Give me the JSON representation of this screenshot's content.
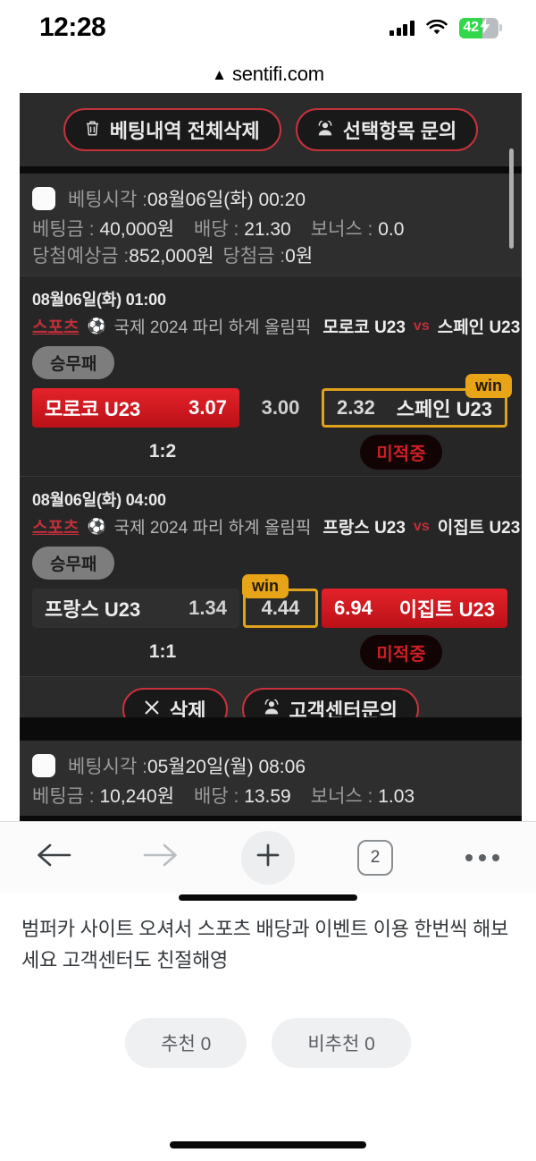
{
  "status_bar": {
    "time": "12:28",
    "battery_percent": "42",
    "battery_charging": true,
    "signal_icon": "cellular-signal-icon",
    "wifi_icon": "wifi-icon"
  },
  "url_bar": {
    "warning_icon": "⚠",
    "host": "sentifi.com"
  },
  "page_toolbar": {
    "delete_all_label": "베팅내역 전체삭제",
    "delete_all_icon": "trash-icon",
    "inquiry_label": "선택항목 문의",
    "inquiry_icon": "agent-headset-icon"
  },
  "slips": [
    {
      "bet_time_label": "베팅시각 :",
      "bet_time_value": "08월06일(화) 00:20",
      "stake_label": "베팅금 : ",
      "stake_value": "40,000원",
      "odds_label": "배당 : ",
      "odds_value": "21.30",
      "bonus_label": "보너스 : ",
      "bonus_value": "0.0",
      "expected_label": "당첨예상금 :",
      "expected_value": "852,000원",
      "payout_label": "당첨금 :",
      "payout_value": "0원",
      "matches": [
        {
          "date": "08월06일(화) 01:00",
          "sports_label": "스포츠",
          "sport_icon": "soccer-ball-icon",
          "league": "국제 2024 파리 하계 올림픽",
          "home_team": "모로코 U23",
          "vs": "vs",
          "away_team": "스페인 U23",
          "market_tag": "승무패",
          "home_odds": "3.07",
          "draw_odds": "3.00",
          "away_odds": "2.32",
          "selected": "away",
          "home_state": "red",
          "away_state": "selected",
          "win_badge": "win",
          "score": "1:2",
          "result_badge": "미적중"
        },
        {
          "date": "08월06일(화) 04:00",
          "sports_label": "스포츠",
          "sport_icon": "soccer-ball-icon",
          "league": "국제 2024 파리 하계 올림픽",
          "home_team": "프랑스 U23",
          "vs": "vs",
          "away_team": "이집트 U23",
          "market_tag": "승무패",
          "home_odds": "1.34",
          "draw_odds": "4.44",
          "away_odds": "6.94",
          "selected": "draw",
          "home_state": "plain",
          "away_state": "red",
          "win_badge": "win",
          "score": "1:1",
          "result_badge": "미적중"
        }
      ],
      "footer": {
        "delete_label": "삭제",
        "delete_icon": "close-x-icon",
        "support_label": "고객센터문의",
        "support_icon": "agent-headset-icon"
      }
    },
    {
      "bet_time_label": "베팅시각 :",
      "bet_time_value": "05월20일(월) 08:06",
      "stake_label": "베팅금 : ",
      "stake_value": "10,240원",
      "odds_label": "배당 : ",
      "odds_value": "13.59",
      "bonus_label": "보너스 : ",
      "bonus_value": "1.03"
    }
  ],
  "browser_toolbar": {
    "back_icon": "arrow-left-icon",
    "forward_icon": "arrow-right-icon",
    "new_tab_icon": "plus-icon",
    "tab_count": "2",
    "more_icon": "more-horizontal-icon"
  },
  "post": {
    "body": "범퍼카 사이트 오셔서 스포츠 배당과 이벤트 이용 한번씩 해보세요 고객센터도 친절해영",
    "upvote_label": "추천 0",
    "downvote_label": "비추천 0"
  },
  "colors": {
    "accent_red": "#c8323c",
    "odds_red": "#e32229",
    "win_amber": "#e8a417",
    "page_bg": "#0b0b0b",
    "card_bg": "#262626",
    "battery_green": "#32d74b"
  }
}
